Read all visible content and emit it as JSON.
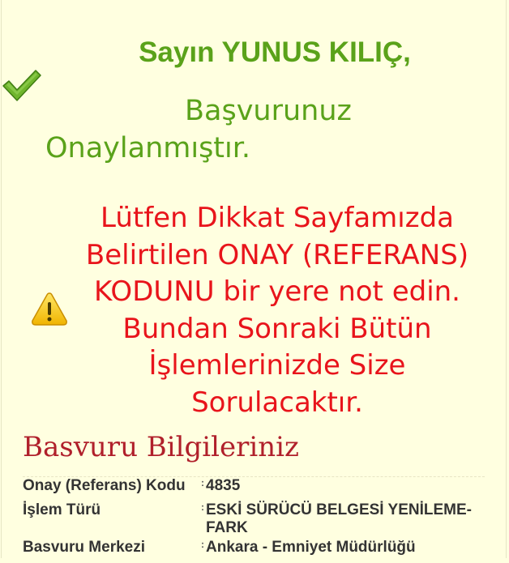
{
  "greeting": "Sayın YUNUS KILIÇ,",
  "approved": {
    "line1": "Başvurunuz",
    "line2": "Onaylanmıştır."
  },
  "warning": {
    "lines": [
      "Lütfen Dikkat Sayfamızda",
      "Belirtilen ONAY (REFERANS)",
      "KODUNU bir yere not edin.",
      "Bundan Sonraki Bütün",
      "İşlemlerinizde Size",
      "Sorulacaktır."
    ]
  },
  "icons": {
    "success": "checkmark-icon",
    "warning": "warning-triangle-icon"
  },
  "section_title": "Basvuru Bilgileriniz",
  "separator": ":",
  "info_rows": [
    {
      "label": "Onay (Referans) Kodu",
      "value": "4835"
    },
    {
      "label": "İşlem Türü",
      "value": "ESKİ SÜRÜCÜ BELGESİ YENİLEME-FARK"
    },
    {
      "label": "Basvuru Merkezi",
      "value": "Ankara - Emniyet Müdürlüğü"
    }
  ],
  "colors": {
    "background": "#ffffe0",
    "success": "#5aa21a",
    "warning": "#e8141b",
    "title": "#b0202b"
  }
}
